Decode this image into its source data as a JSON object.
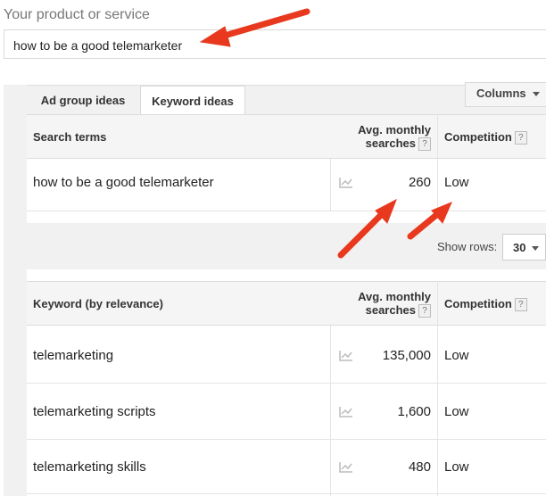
{
  "product": {
    "label": "Your product or service",
    "value": "how to be a good telemarketer"
  },
  "tabs": {
    "ad_group": "Ad group ideas",
    "keyword": "Keyword ideas"
  },
  "columns_button": "Columns",
  "search_table": {
    "col_term": "Search terms",
    "col_avg_line1": "Avg. monthly",
    "col_avg_line2": "searches",
    "col_competition": "Competition",
    "help": "?",
    "rows": [
      {
        "term": "how to be a good telemarketer",
        "searches": "260",
        "competition": "Low"
      }
    ]
  },
  "show_rows": {
    "label": "Show rows:",
    "value": "30"
  },
  "keyword_table": {
    "col_keyword": "Keyword (by relevance)",
    "col_avg_line1": "Avg. monthly",
    "col_avg_line2": "searches",
    "col_competition": "Competition",
    "help": "?",
    "rows": [
      {
        "term": "telemarketing",
        "searches": "135,000",
        "competition": "Low"
      },
      {
        "term": "telemarketing scripts",
        "searches": "1,600",
        "competition": "Low"
      },
      {
        "term": "telemarketing skills",
        "searches": "480",
        "competition": "Low"
      }
    ]
  },
  "colors": {
    "arrow": "#e8391f",
    "header_bg": "#f5f5f5",
    "panel_bg": "#f1f1f1"
  },
  "icons": [
    "trend-chart-icon",
    "help-icon",
    "dropdown-caret-icon",
    "annotation-arrow"
  ]
}
